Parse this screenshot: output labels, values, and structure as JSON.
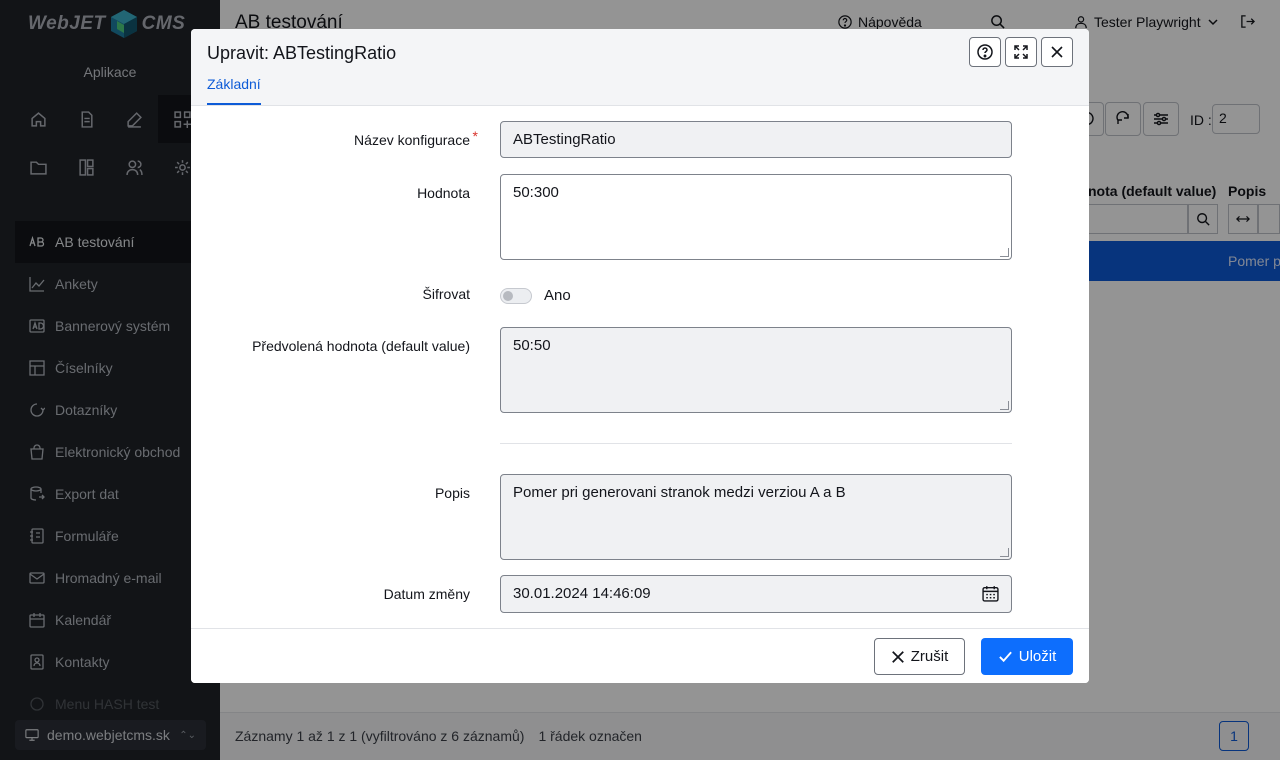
{
  "app": {
    "logo_left": "WebJET",
    "logo_right": "CMS",
    "section": "Aplikace"
  },
  "sidebar": {
    "icons_row1": [
      "home-icon",
      "document-icon",
      "edit-icon",
      "apps-icon"
    ],
    "icons_row2": [
      "folder-icon",
      "layout-icon",
      "users-icon",
      "gear-icon"
    ],
    "items": [
      {
        "label": "AB testování",
        "icon": "ab-icon"
      },
      {
        "label": "Ankety",
        "icon": "chart-icon"
      },
      {
        "label": "Bannerový systém",
        "icon": "ad-icon"
      },
      {
        "label": "Číselníky",
        "icon": "table-icon"
      },
      {
        "label": "Dotazníky",
        "icon": "survey-icon"
      },
      {
        "label": "Elektronický obchod",
        "icon": "bag-icon"
      },
      {
        "label": "Export dat",
        "icon": "export-icon"
      },
      {
        "label": "Formuláře",
        "icon": "form-icon"
      },
      {
        "label": "Hromadný e-mail",
        "icon": "mail-icon"
      },
      {
        "label": "Kalendář",
        "icon": "calendar-icon"
      },
      {
        "label": "Kontakty",
        "icon": "contacts-icon"
      },
      {
        "label": "Menu HASH test",
        "icon": "menu-icon"
      }
    ],
    "domain": "demo.webjetcms.sk"
  },
  "header": {
    "title": "AB testování",
    "help": "Nápověda",
    "user": "Tester Playwright"
  },
  "table": {
    "id_label": "ID :",
    "id_value": "2",
    "col_default": "nota (default value)",
    "col_popis": "Popis",
    "selected_row_popis": "Pomer pri",
    "footer_info": "Záznamy 1 až 1 z 1 (vyfiltrováno z 6 záznamů)",
    "footer_selected": "1 řádek označen",
    "page": "1"
  },
  "modal": {
    "title": "Upravit: ABTestingRatio",
    "tab": "Základní",
    "fields": {
      "name_label": "Název konfigurace",
      "name_value": "ABTestingRatio",
      "value_label": "Hodnota",
      "value_value": "50:300",
      "encrypt_label": "Šifrovat",
      "encrypt_option": "Ano",
      "default_label": "Předvolená hodnota (default value)",
      "default_value": "50:50",
      "desc_label": "Popis",
      "desc_value": "Pomer pri generovani stranok medzi verziou A a B",
      "date_label": "Datum změny",
      "date_value": "30.01.2024 14:46:09"
    },
    "cancel": "Zrušit",
    "save": "Uložit"
  },
  "colors": {
    "accent": "#0d6efd",
    "sidebar_bg": "#1f2329",
    "required": "#d9322b"
  }
}
